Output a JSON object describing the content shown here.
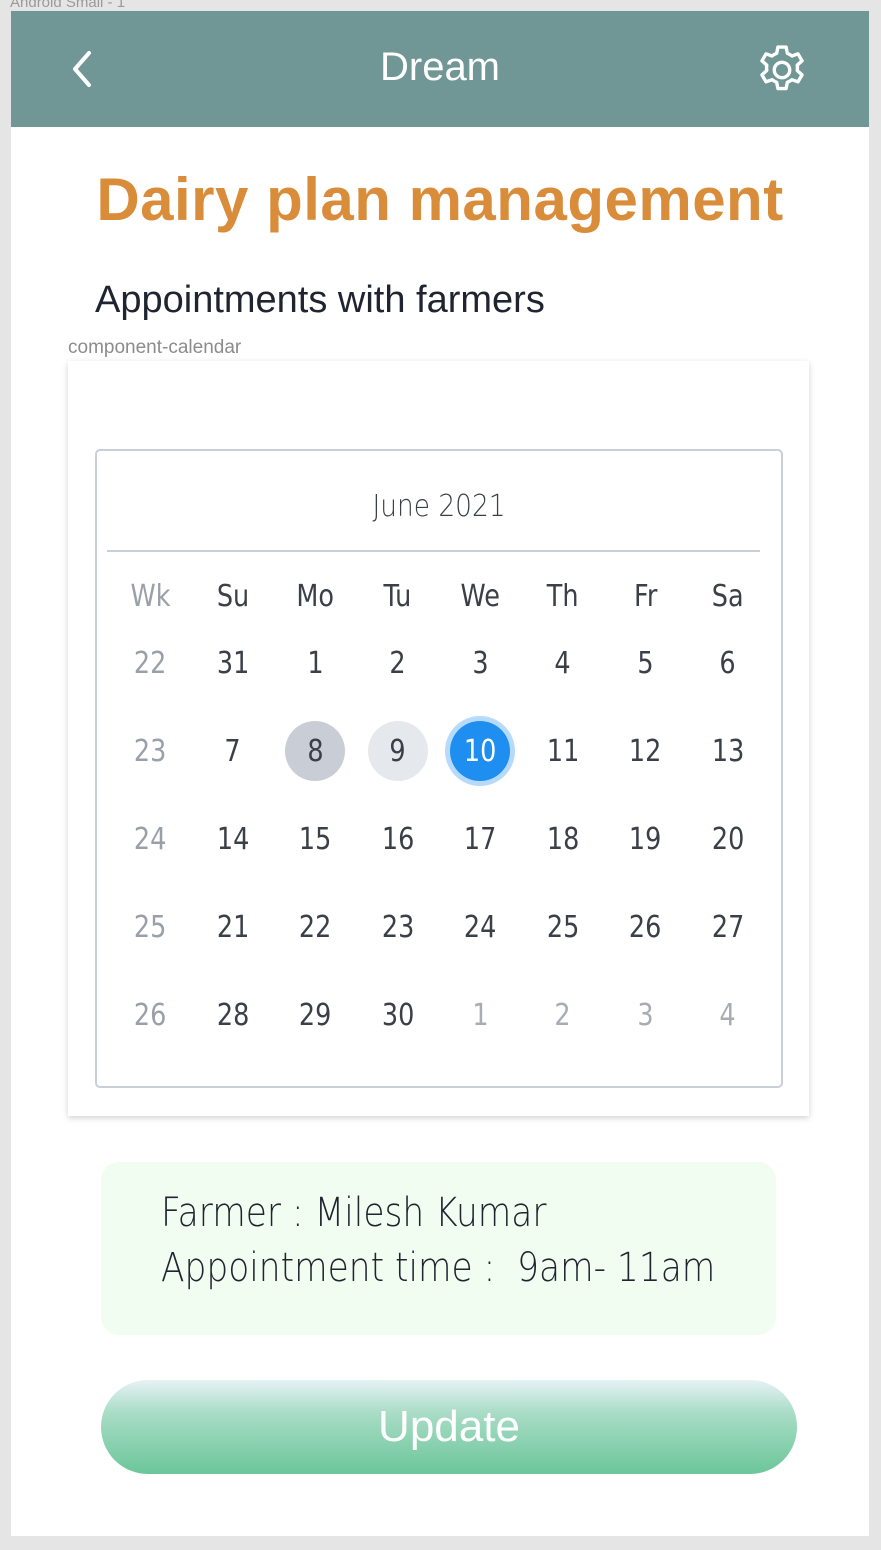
{
  "frame_label": "Android Small - 1",
  "appbar": {
    "title": "Dream",
    "back_icon": "chevron-left-icon",
    "settings_icon": "gear-icon",
    "color": "#719696"
  },
  "page": {
    "title": "Dairy plan management",
    "subtitle": "Appointments with farmers",
    "component_label": "component-calendar",
    "title_color": "#d98c3a"
  },
  "calendar": {
    "month_label": "June 2021",
    "headers": [
      "Wk",
      "Su",
      "Mo",
      "Tu",
      "We",
      "Th",
      "Fr",
      "Sa"
    ],
    "weeks": [
      {
        "wk": "22",
        "days": [
          {
            "d": "31",
            "muted": false
          },
          {
            "d": "1",
            "muted": false
          },
          {
            "d": "2",
            "muted": false
          },
          {
            "d": "3",
            "muted": false
          },
          {
            "d": "4",
            "muted": false
          },
          {
            "d": "5",
            "muted": false
          },
          {
            "d": "6",
            "muted": false
          }
        ]
      },
      {
        "wk": "23",
        "days": [
          {
            "d": "7",
            "muted": false
          },
          {
            "d": "8",
            "state": "range-dark"
          },
          {
            "d": "9",
            "state": "range-light"
          },
          {
            "d": "10",
            "state": "selected"
          },
          {
            "d": "11"
          },
          {
            "d": "12"
          },
          {
            "d": "13"
          }
        ]
      },
      {
        "wk": "24",
        "days": [
          {
            "d": "14"
          },
          {
            "d": "15"
          },
          {
            "d": "16"
          },
          {
            "d": "17"
          },
          {
            "d": "18"
          },
          {
            "d": "19"
          },
          {
            "d": "20"
          }
        ]
      },
      {
        "wk": "25",
        "days": [
          {
            "d": "21"
          },
          {
            "d": "22"
          },
          {
            "d": "23"
          },
          {
            "d": "24"
          },
          {
            "d": "25"
          },
          {
            "d": "26"
          },
          {
            "d": "27"
          }
        ]
      },
      {
        "wk": "26",
        "days": [
          {
            "d": "28"
          },
          {
            "d": "29"
          },
          {
            "d": "30"
          },
          {
            "d": "1",
            "muted": true
          },
          {
            "d": "2",
            "muted": true
          },
          {
            "d": "3",
            "muted": true
          },
          {
            "d": "4",
            "muted": true
          }
        ]
      }
    ],
    "selected_color": "#1e8ef0"
  },
  "appointment": {
    "farmer_line": "Farmer : Milesh Kumar",
    "time_line": "Appointment time :  9am- 11am"
  },
  "update_button": {
    "label": "Update"
  }
}
